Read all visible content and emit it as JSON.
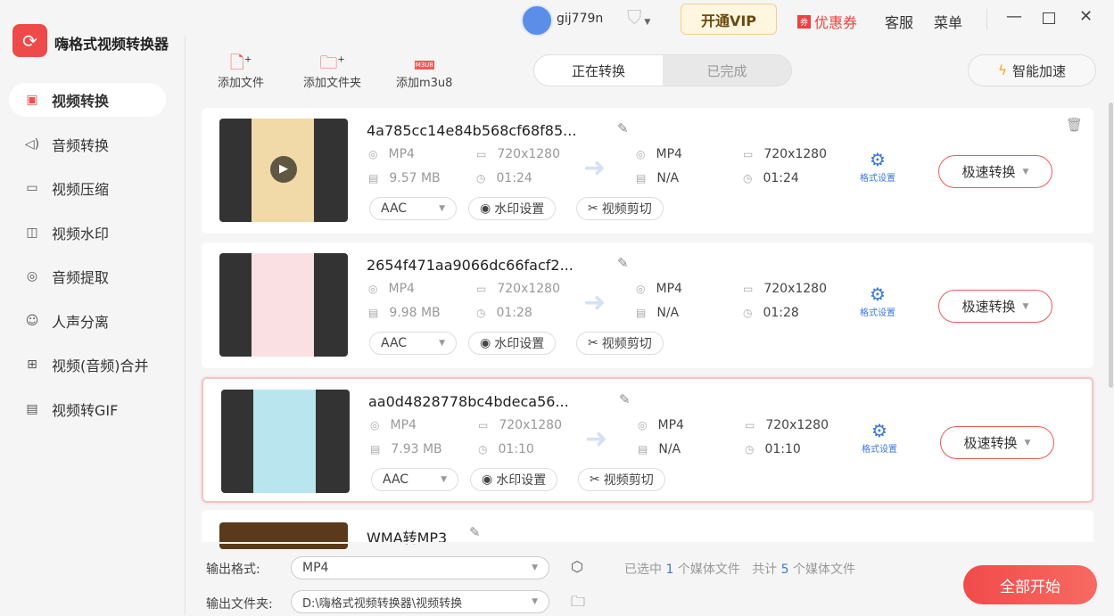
{
  "app": {
    "title": "嗨格式视频转换器",
    "logo_icon": "refresh-logo-icon"
  },
  "header": {
    "username": "gij779n",
    "vip_button": "开通VIP",
    "coupon": "优惠券",
    "coupon_badge": "券",
    "service": "客服",
    "menu": "菜单"
  },
  "sidebar": {
    "items": [
      {
        "label": "视频转换",
        "icon": "video-convert-icon",
        "active": true
      },
      {
        "label": "音频转换",
        "icon": "audio-icon"
      },
      {
        "label": "视频压缩",
        "icon": "compress-icon"
      },
      {
        "label": "视频水印",
        "icon": "watermark-icon"
      },
      {
        "label": "音频提取",
        "icon": "extract-icon"
      },
      {
        "label": "人声分离",
        "icon": "voice-icon"
      },
      {
        "label": "视频(音频)合并",
        "icon": "merge-icon"
      },
      {
        "label": "视频转GIF",
        "icon": "gif-icon"
      }
    ]
  },
  "toolbar": {
    "add_file": "添加文件",
    "add_folder": "添加文件夹",
    "add_m3u8": "添加m3u8",
    "m3u8_badge": "M3U8"
  },
  "tabs": {
    "converting": "正在转换",
    "done": "已完成"
  },
  "accelerate": "智能加速",
  "files": [
    {
      "name": "4a785cc14e84b568cf68f85...",
      "src_format": "MP4",
      "src_res": "720x1280",
      "src_size": "9.57 MB",
      "src_dur": "01:24",
      "dst_format": "MP4",
      "dst_res": "720x1280",
      "dst_size": "N/A",
      "dst_dur": "01:24",
      "audio": "AAC",
      "thumb_color": "#f1d9a8"
    },
    {
      "name": "2654f471aa9066dc66facf2...",
      "src_format": "MP4",
      "src_res": "720x1280",
      "src_size": "9.98 MB",
      "src_dur": "01:28",
      "dst_format": "MP4",
      "dst_res": "720x1280",
      "dst_size": "N/A",
      "dst_dur": "01:28",
      "audio": "AAC",
      "thumb_color": "#fbe0e3"
    },
    {
      "name": "aa0d4828778bc4bdeca56...",
      "src_format": "MP4",
      "src_res": "720x1280",
      "src_size": "7.93 MB",
      "src_dur": "01:10",
      "dst_format": "MP4",
      "dst_res": "720x1280",
      "dst_size": "N/A",
      "dst_dur": "01:10",
      "audio": "AAC",
      "thumb_color": "#b9e6ee"
    },
    {
      "name": "WMA转MP3"
    }
  ],
  "card_labels": {
    "format_settings": "格式设置",
    "fast_convert": "极速转换",
    "watermark": "水印设置",
    "cut": "视频剪切"
  },
  "footer": {
    "format_label": "输出格式:",
    "format_value": "MP4",
    "folder_label": "输出文件夹:",
    "folder_value": "D:\\嗨格式视频转换器\\视频转换",
    "selected_prefix": "已选中",
    "selected_count": "1",
    "selected_suffix": "个媒体文件",
    "total_prefix": "共计",
    "total_count": "5",
    "total_suffix": "个媒体文件",
    "start_all": "全部开始"
  }
}
